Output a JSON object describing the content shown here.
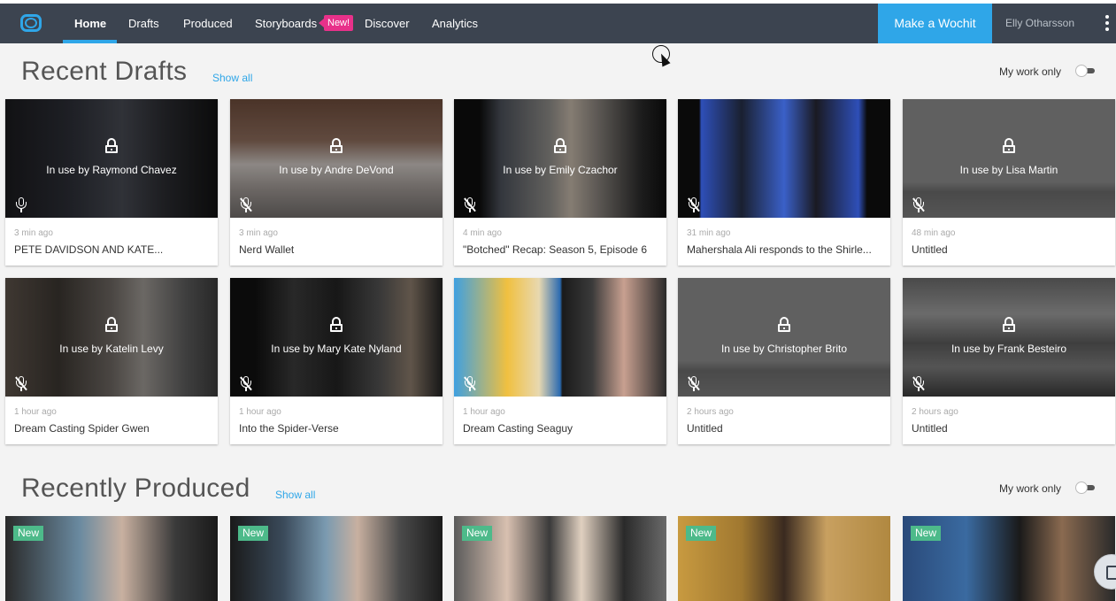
{
  "nav": {
    "items": [
      {
        "label": "Home"
      },
      {
        "label": "Drafts"
      },
      {
        "label": "Produced"
      },
      {
        "label": "Storyboards"
      },
      {
        "label": "Discover"
      },
      {
        "label": "Analytics"
      }
    ],
    "new_badge": "New!",
    "make_button": "Make a Wochit",
    "user_name": "Elly Otharsson",
    "accent_color": "#2fa6e8",
    "bg_color": "#3c4450"
  },
  "drafts": {
    "title": "Recent Drafts",
    "show_all": "Show all",
    "my_work_only": "My work only",
    "cards": [
      {
        "in_use": "In use by Raymond Chavez",
        "time": "3 min ago",
        "title": "PETE DAVIDSON AND KATE..."
      },
      {
        "in_use": "In use by Andre DeVond",
        "time": "3 min ago",
        "title": "Nerd Wallet"
      },
      {
        "in_use": "In use by Emily Czachor",
        "time": "4 min ago",
        "title": "\"Botched\" Recap: Season 5, Episode 6"
      },
      {
        "in_use": "",
        "time": "31 min ago",
        "title": "Mahershala Ali responds to the Shirle..."
      },
      {
        "in_use": "In use by Lisa Martin",
        "time": "48 min ago",
        "title": "Untitled"
      },
      {
        "in_use": "In use by Katelin Levy",
        "time": "1 hour ago",
        "title": "Dream Casting Spider Gwen"
      },
      {
        "in_use": "In use by Mary Kate Nyland",
        "time": "1 hour ago",
        "title": "Into the Spider-Verse"
      },
      {
        "in_use": "",
        "time": "1 hour ago",
        "title": "Dream Casting Seaguy"
      },
      {
        "in_use": "In use by Christopher Brito",
        "time": "2 hours ago",
        "title": "Untitled"
      },
      {
        "in_use": "In use by Frank Besteiro",
        "time": "2 hours ago",
        "title": "Untitled"
      }
    ]
  },
  "produced": {
    "title": "Recently Produced",
    "show_all": "Show all",
    "my_work_only": "My work only",
    "new_tag": "New"
  }
}
